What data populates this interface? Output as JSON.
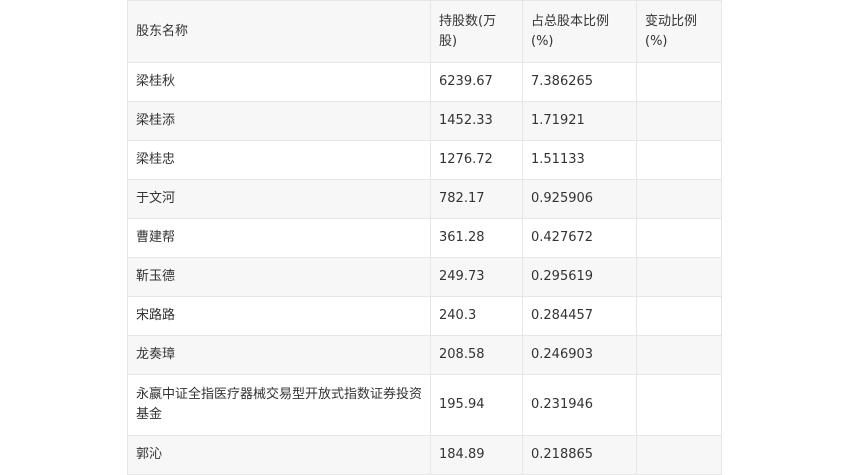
{
  "table": {
    "headers": [
      "股东名称",
      "持股数(万股)",
      "占总股本比例(%)",
      "变动比例(%)"
    ],
    "rows": [
      [
        "梁桂秋",
        "6239.67",
        "7.386265",
        ""
      ],
      [
        "梁桂添",
        "1452.33",
        "1.71921",
        ""
      ],
      [
        "梁桂忠",
        "1276.72",
        "1.51133",
        ""
      ],
      [
        "于文河",
        "782.17",
        "0.925906",
        ""
      ],
      [
        "曹建帮",
        "361.28",
        "0.427672",
        ""
      ],
      [
        "靳玉德",
        "249.73",
        "0.295619",
        ""
      ],
      [
        "宋路路",
        "240.3",
        "0.284457",
        ""
      ],
      [
        "龙奏璋",
        "208.58",
        "0.246903",
        ""
      ],
      [
        "永嬴中证全指医疗器械交易型开放式指数证券投资基金",
        "195.94",
        "0.231946",
        ""
      ],
      [
        "郭沁",
        "184.89",
        "0.218865",
        ""
      ]
    ]
  }
}
